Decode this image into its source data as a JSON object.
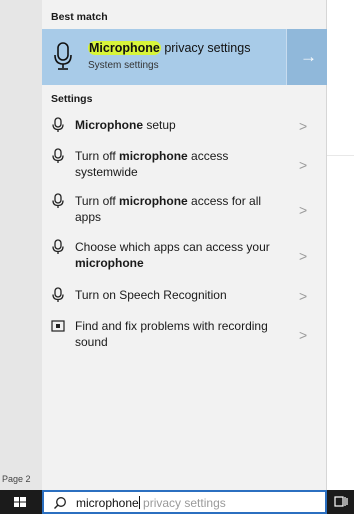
{
  "background": {
    "page_label": "Page 2"
  },
  "panel": {
    "best_match_header": "Best match",
    "best_match": {
      "title_highlight": "Microphone",
      "title_rest": " privacy settings",
      "subtitle": "System settings",
      "arrow": "→"
    },
    "settings_header": "Settings",
    "settings_items": [
      {
        "icon": "microphone-icon",
        "bold": "Microphone",
        "after": " setup"
      },
      {
        "icon": "microphone-icon",
        "before": "Turn off ",
        "bold": "microphone",
        "after": " access systemwide"
      },
      {
        "icon": "microphone-icon",
        "before": "Turn off ",
        "bold": "microphone",
        "after": " access for all apps"
      },
      {
        "icon": "microphone-icon",
        "before": "Choose which apps can access your ",
        "bold": "microphone"
      },
      {
        "icon": "microphone-icon",
        "before": "Turn on Speech Recognition"
      },
      {
        "icon": "troubleshoot-icon",
        "before": "Find and fix problems with recording sound"
      }
    ],
    "chevron": "〉"
  },
  "taskbar": {
    "search_query": "microphone",
    "search_suggestion": " privacy settings"
  },
  "colors": {
    "selected_bg": "#a8cbe8",
    "highlight": "#d8f53a",
    "search_border": "#2b6fc0",
    "taskbar": "#1b1b1b"
  }
}
